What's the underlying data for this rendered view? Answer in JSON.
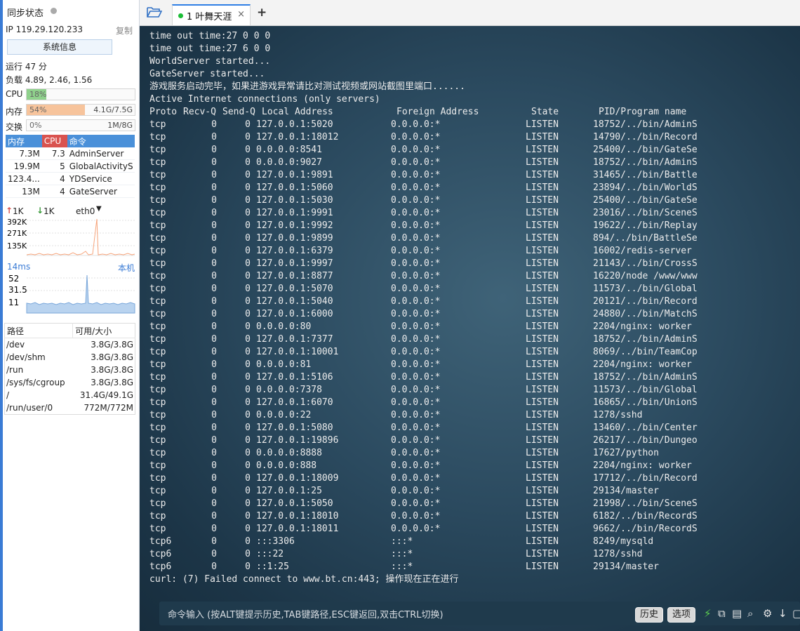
{
  "sidebar": {
    "sync_label": "同步状态",
    "ip_label": "IP 119.29.120.233",
    "copy_label": "复制",
    "sysinfo_button": "系统信息",
    "uptime": "运行 47 分",
    "load": "负载 4.89, 2.46, 1.56",
    "cpu": {
      "label": "CPU",
      "pct_text": "18%",
      "fraction": 0.18
    },
    "mem": {
      "label": "内存",
      "pct_text": "54%",
      "amount": "4.1G/7.5G",
      "fraction": 0.54
    },
    "swap": {
      "label": "交换",
      "pct_text": "0%",
      "amount": "1M/8G",
      "fraction": 0.0
    },
    "proc_headers": [
      "内存",
      "CPU",
      "命令"
    ],
    "processes": [
      {
        "mem": "7.3M",
        "cpu": "7.3",
        "cmd": "AdminServer"
      },
      {
        "mem": "19.9M",
        "cpu": "5",
        "cmd": "GlobalActivityS"
      },
      {
        "mem": "123.4...",
        "cpu": "4",
        "cmd": "YDService"
      },
      {
        "mem": "13M",
        "cpu": "4",
        "cmd": "GateServer"
      }
    ],
    "net": {
      "up": "1K",
      "down": "1K",
      "iface": "eth0",
      "ticks": [
        "392K",
        "271K",
        "135K"
      ]
    },
    "ping": {
      "latency": "14ms",
      "target": "本机",
      "ticks": [
        "52",
        "31.5",
        "11"
      ]
    },
    "disk_headers": [
      "路径",
      "可用/大小"
    ],
    "disks": [
      {
        "path": "/dev",
        "size": "3.8G/3.8G"
      },
      {
        "path": "/dev/shm",
        "size": "3.8G/3.8G"
      },
      {
        "path": "/run",
        "size": "3.8G/3.8G"
      },
      {
        "path": "/sys/fs/cgroup",
        "size": "3.8G/3.8G"
      },
      {
        "path": "/",
        "size": "31.4G/49.1G"
      },
      {
        "path": "/run/user/0",
        "size": "772M/772M"
      }
    ]
  },
  "tabs": [
    {
      "label": "1 叶舞天涯",
      "close": "×"
    }
  ],
  "new_tab": "+",
  "terminal": {
    "pre_lines": [
      "time out time:27 0 0 0",
      "time out time:27 6 0 0",
      "WorldServer started...",
      "GateServer started...",
      "游戏服务启动完毕，如果进游戏异常请比对测试视频或网站截图里端口......",
      "Active Internet connections (only servers)"
    ],
    "header": [
      "Proto",
      "Recv-Q",
      "Send-Q",
      "Local Address",
      "Foreign Address",
      "State",
      "PID/Program name"
    ],
    "rows": [
      [
        "tcp",
        "0",
        "0",
        "127.0.0.1:5020",
        "0.0.0.0:*",
        "LISTEN",
        "18752/../bin/AdminS"
      ],
      [
        "tcp",
        "0",
        "0",
        "127.0.0.1:18012",
        "0.0.0.0:*",
        "LISTEN",
        "14790/../bin/Record"
      ],
      [
        "tcp",
        "0",
        "0",
        "0.0.0.0:8541",
        "0.0.0.0:*",
        "LISTEN",
        "25400/../bin/GateSe"
      ],
      [
        "tcp",
        "0",
        "0",
        "0.0.0.0:9027",
        "0.0.0.0:*",
        "LISTEN",
        "18752/../bin/AdminS"
      ],
      [
        "tcp",
        "0",
        "0",
        "127.0.0.1:9891",
        "0.0.0.0:*",
        "LISTEN",
        "31465/../bin/Battle"
      ],
      [
        "tcp",
        "0",
        "0",
        "127.0.0.1:5060",
        "0.0.0.0:*",
        "LISTEN",
        "23894/../bin/WorldS"
      ],
      [
        "tcp",
        "0",
        "0",
        "127.0.0.1:5030",
        "0.0.0.0:*",
        "LISTEN",
        "25400/../bin/GateSe"
      ],
      [
        "tcp",
        "0",
        "0",
        "127.0.0.1:9991",
        "0.0.0.0:*",
        "LISTEN",
        "23016/../bin/SceneS"
      ],
      [
        "tcp",
        "0",
        "0",
        "127.0.0.1:9992",
        "0.0.0.0:*",
        "LISTEN",
        "19622/../bin/Replay"
      ],
      [
        "tcp",
        "0",
        "0",
        "127.0.0.1:9899",
        "0.0.0.0:*",
        "LISTEN",
        "894/../bin/BattleSe"
      ],
      [
        "tcp",
        "0",
        "0",
        "127.0.0.1:6379",
        "0.0.0.0:*",
        "LISTEN",
        "16002/redis-server"
      ],
      [
        "tcp",
        "0",
        "0",
        "127.0.0.1:9997",
        "0.0.0.0:*",
        "LISTEN",
        "21143/../bin/CrossS"
      ],
      [
        "tcp",
        "0",
        "0",
        "127.0.0.1:8877",
        "0.0.0.0:*",
        "LISTEN",
        "16220/node /www/www"
      ],
      [
        "tcp",
        "0",
        "0",
        "127.0.0.1:5070",
        "0.0.0.0:*",
        "LISTEN",
        "11573/../bin/Global"
      ],
      [
        "tcp",
        "0",
        "0",
        "127.0.0.1:5040",
        "0.0.0.0:*",
        "LISTEN",
        "20121/../bin/Record"
      ],
      [
        "tcp",
        "0",
        "0",
        "127.0.0.1:6000",
        "0.0.0.0:*",
        "LISTEN",
        "24880/../bin/MatchS"
      ],
      [
        "tcp",
        "0",
        "0",
        "0.0.0.0:80",
        "0.0.0.0:*",
        "LISTEN",
        "2204/nginx: worker"
      ],
      [
        "tcp",
        "0",
        "0",
        "127.0.0.1:7377",
        "0.0.0.0:*",
        "LISTEN",
        "18752/../bin/AdminS"
      ],
      [
        "tcp",
        "0",
        "0",
        "127.0.0.1:10001",
        "0.0.0.0:*",
        "LISTEN",
        "8069/../bin/TeamCop"
      ],
      [
        "tcp",
        "0",
        "0",
        "0.0.0.0:81",
        "0.0.0.0:*",
        "LISTEN",
        "2204/nginx: worker"
      ],
      [
        "tcp",
        "0",
        "0",
        "127.0.0.1:5106",
        "0.0.0.0:*",
        "LISTEN",
        "18752/../bin/AdminS"
      ],
      [
        "tcp",
        "0",
        "0",
        "0.0.0.0:7378",
        "0.0.0.0:*",
        "LISTEN",
        "11573/../bin/Global"
      ],
      [
        "tcp",
        "0",
        "0",
        "127.0.0.1:6070",
        "0.0.0.0:*",
        "LISTEN",
        "16865/../bin/UnionS"
      ],
      [
        "tcp",
        "0",
        "0",
        "0.0.0.0:22",
        "0.0.0.0:*",
        "LISTEN",
        "1278/sshd"
      ],
      [
        "tcp",
        "0",
        "0",
        "127.0.0.1:5080",
        "0.0.0.0:*",
        "LISTEN",
        "13460/../bin/Center"
      ],
      [
        "tcp",
        "0",
        "0",
        "127.0.0.1:19896",
        "0.0.0.0:*",
        "LISTEN",
        "26217/../bin/Dungeo"
      ],
      [
        "tcp",
        "0",
        "0",
        "0.0.0.0:8888",
        "0.0.0.0:*",
        "LISTEN",
        "17627/python"
      ],
      [
        "tcp",
        "0",
        "0",
        "0.0.0.0:888",
        "0.0.0.0:*",
        "LISTEN",
        "2204/nginx: worker"
      ],
      [
        "tcp",
        "0",
        "0",
        "127.0.0.1:18009",
        "0.0.0.0:*",
        "LISTEN",
        "17712/../bin/Record"
      ],
      [
        "tcp",
        "0",
        "0",
        "127.0.0.1:25",
        "0.0.0.0:*",
        "LISTEN",
        "29134/master"
      ],
      [
        "tcp",
        "0",
        "0",
        "127.0.0.1:5050",
        "0.0.0.0:*",
        "LISTEN",
        "21998/../bin/SceneS"
      ],
      [
        "tcp",
        "0",
        "0",
        "127.0.0.1:18010",
        "0.0.0.0:*",
        "LISTEN",
        "6182/../bin/RecordS"
      ],
      [
        "tcp",
        "0",
        "0",
        "127.0.0.1:18011",
        "0.0.0.0:*",
        "LISTEN",
        "9662/../bin/RecordS"
      ],
      [
        "tcp6",
        "0",
        "0",
        ":::3306",
        ":::*",
        "LISTEN",
        "8249/mysqld"
      ],
      [
        "tcp6",
        "0",
        "0",
        ":::22",
        ":::*",
        "LISTEN",
        "1278/sshd"
      ],
      [
        "tcp6",
        "0",
        "0",
        "::1:25",
        ":::*",
        "LISTEN",
        "29134/master"
      ]
    ],
    "post_lines": [
      "curl: (7) Failed connect to www.bt.cn:443; 操作现在正在进行"
    ]
  },
  "command_bar": {
    "placeholder": "命令输入 (按ALT键提示历史,TAB键路径,ESC键返回,双击CTRL切换)",
    "history_button": "历史",
    "options_button": "选项"
  },
  "colors": {
    "cpu_bar": "#8fd18c",
    "mem_bar": "#f7c49c",
    "proc_mem_header": "#4a90d9",
    "proc_cpu_header": "#d9534f",
    "proc_cmd_header": "#4a90d9",
    "accent": "#2f7fe5"
  }
}
